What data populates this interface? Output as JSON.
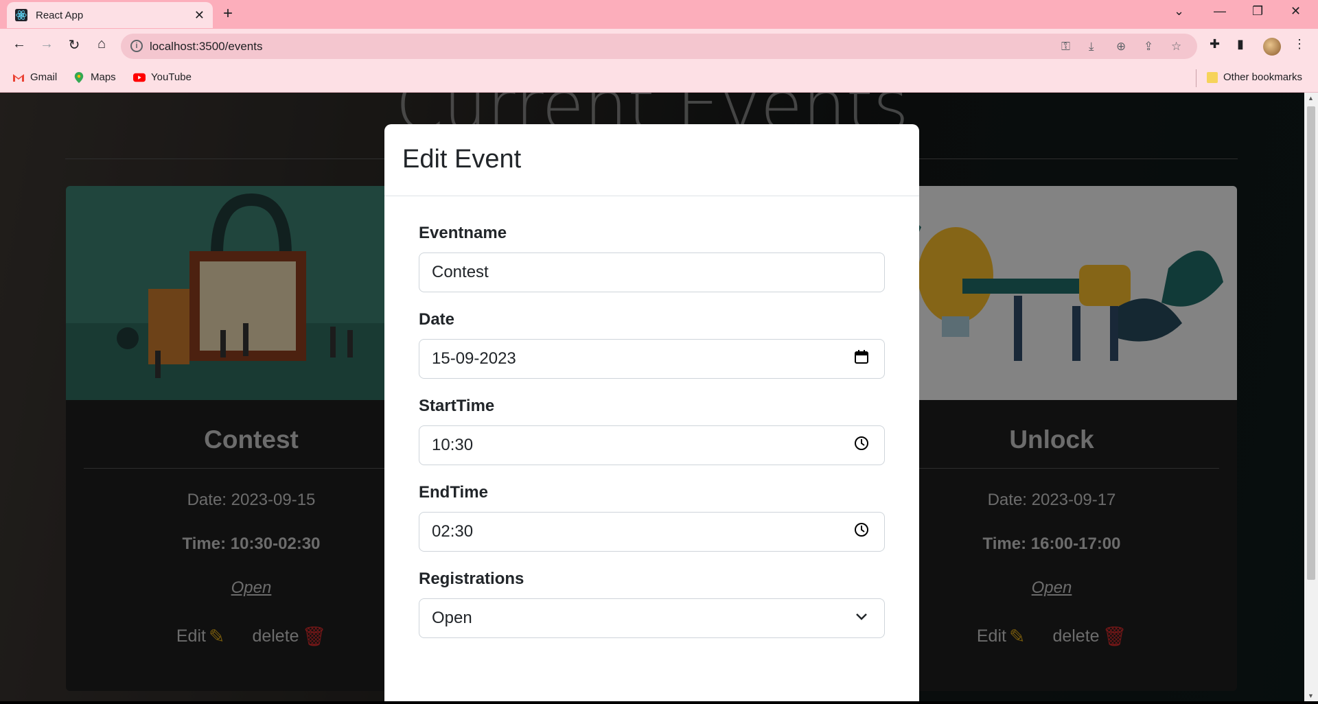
{
  "browser": {
    "tab_title": "React App",
    "url": "localhost:3500/events",
    "bookmarks": [
      "Gmail",
      "Maps",
      "YouTube"
    ],
    "other_bookmarks": "Other bookmarks"
  },
  "page": {
    "heading": "Current Events",
    "cards": [
      {
        "name": "Contest",
        "date": "Date: 2023-09-15",
        "time": "Time: 10:30-02:30",
        "status": "Open",
        "edit": "Edit",
        "delete": "delete"
      },
      {
        "name": "Unlock",
        "date": "Date: 2023-09-17",
        "time": "Time: 16:00-17:00",
        "status": "Open",
        "edit": "Edit",
        "delete": "delete"
      }
    ]
  },
  "modal": {
    "title": "Edit Event",
    "fields": {
      "eventname": {
        "label": "Eventname",
        "value": "Contest"
      },
      "date": {
        "label": "Date",
        "value": "15-09-2023"
      },
      "starttime": {
        "label": "StartTime",
        "value": "10:30"
      },
      "endtime": {
        "label": "EndTime",
        "value": "02:30"
      },
      "registrations": {
        "label": "Registrations",
        "value": "Open"
      }
    }
  },
  "colors": {
    "tab_bar": "#fcaebb",
    "toolbar": "#fde0e5",
    "edit_icon": "#d4a017",
    "delete_icon": "#d12b2b"
  }
}
